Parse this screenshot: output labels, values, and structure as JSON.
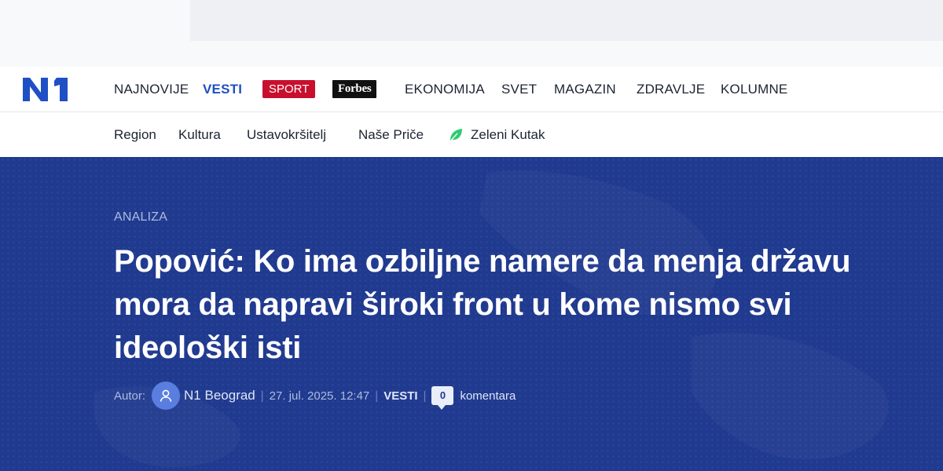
{
  "header": {
    "logo_text": "N1",
    "nav": [
      {
        "label": "NAJNOVIJE"
      },
      {
        "label": "VESTI"
      },
      {
        "label": "SPORT"
      },
      {
        "label": "Forbes"
      },
      {
        "label": "EKONOMIJA"
      },
      {
        "label": "SVET"
      },
      {
        "label": "MAGAZIN"
      },
      {
        "label": "ZDRAVLJE"
      },
      {
        "label": "KOLUMNE"
      }
    ],
    "active_nav": "VESTI",
    "colors": {
      "brand": "#1f4fc4",
      "sport": "#c8102e",
      "forbes": "#111111"
    }
  },
  "subnav": {
    "items": [
      {
        "label": "Region"
      },
      {
        "label": "Kultura"
      },
      {
        "label": "Ustavokršitelj"
      },
      {
        "label": "Naše Priče"
      },
      {
        "label": "Zeleni Kutak",
        "icon": "leaf-icon"
      }
    ]
  },
  "article": {
    "category": "ANALIZA",
    "title": "Popović: Ko ima ozbiljne namere da menja državu mora da napravi široki front u kome nismo svi ideološki isti",
    "meta": {
      "author_prefix": "Autor:",
      "author": "N1 Beograd",
      "date": "27. jul. 2025. 12:47",
      "section": "VESTI",
      "comment_count": "0",
      "comments_label": "komentara"
    },
    "colors": {
      "hero_background": "#203a8f"
    }
  }
}
